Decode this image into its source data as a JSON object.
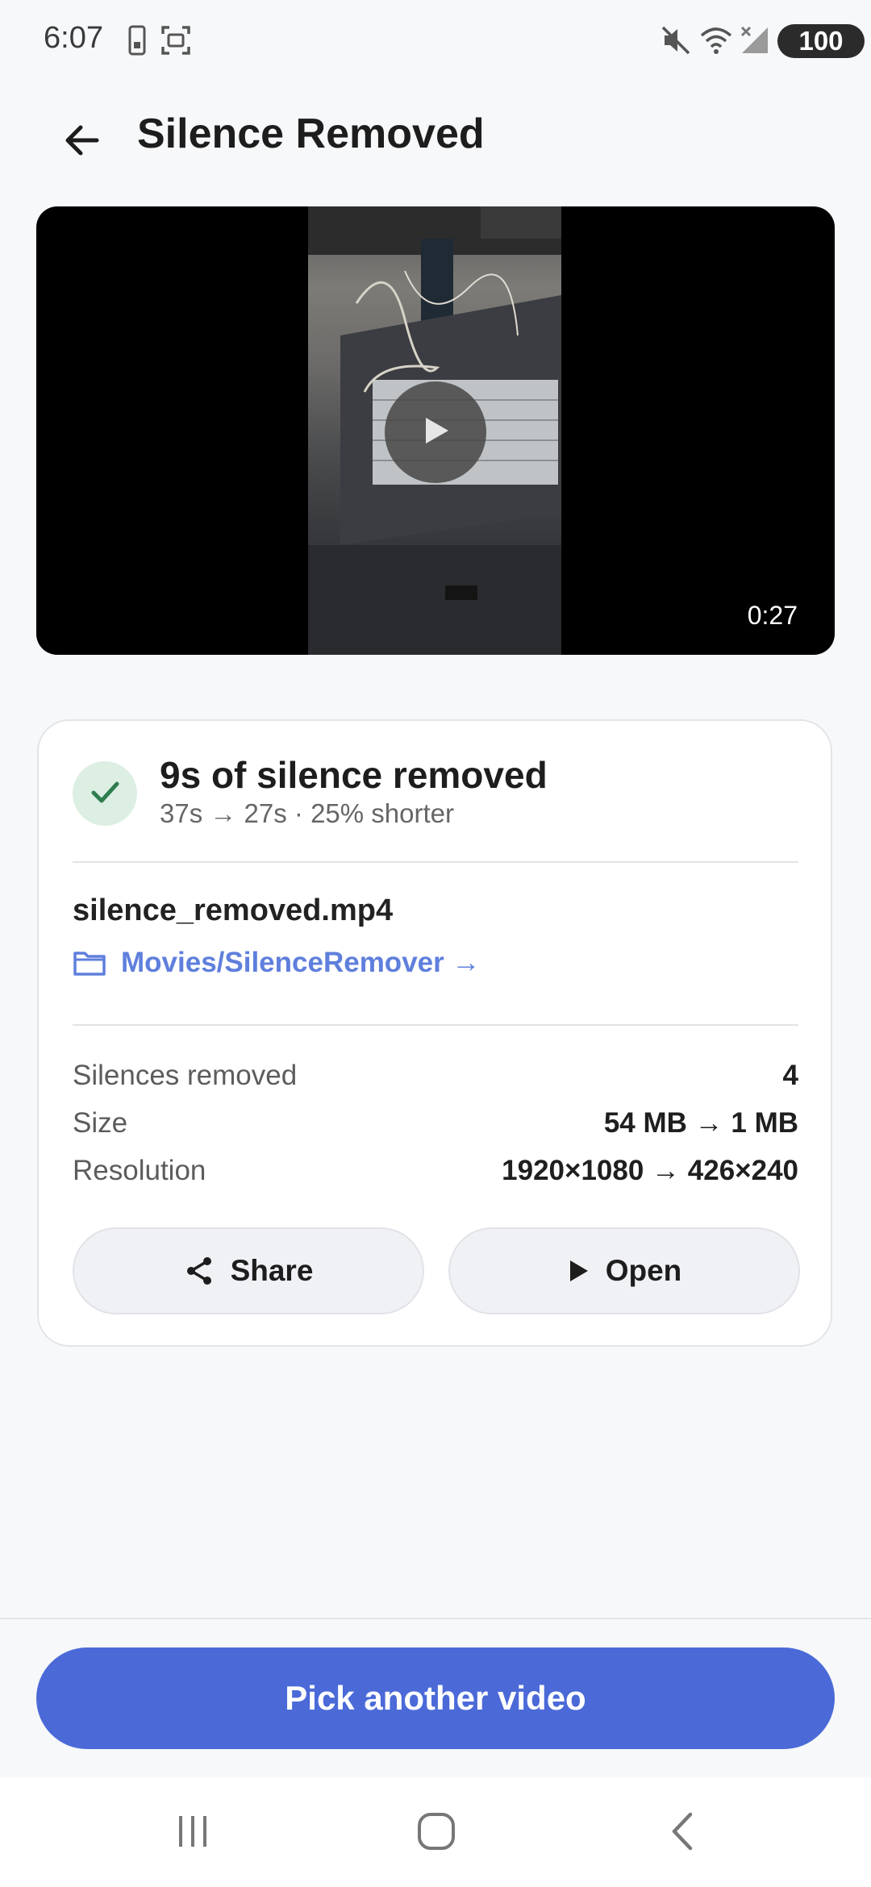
{
  "status_bar": {
    "time": "6:07",
    "battery": "100"
  },
  "app_bar": {
    "title": "Silence Removed"
  },
  "video": {
    "duration": "0:27"
  },
  "summary": {
    "title": "9s of silence removed",
    "subtitle": "37s → 27s · 25% shorter"
  },
  "file": {
    "name": "silence_removed.mp4",
    "folder": "Movies/SilenceRemover →"
  },
  "stats": [
    {
      "label": "Silences removed",
      "value": "4"
    },
    {
      "label": "Size",
      "value": "54 MB → 1 MB"
    },
    {
      "label": "Resolution",
      "value": "1920×1080 → 426×240"
    }
  ],
  "actions": {
    "share": "Share",
    "open": "Open"
  },
  "primary_action": "Pick another video",
  "colors": {
    "accent": "#4b6ad8",
    "link": "#5f7fdc",
    "success": "#2e7d4f"
  },
  "icons": [
    "back-arrow-icon",
    "play-icon",
    "check-icon",
    "folder-icon",
    "share-icon",
    "recent-apps-icon",
    "home-icon",
    "nav-back-icon"
  ]
}
